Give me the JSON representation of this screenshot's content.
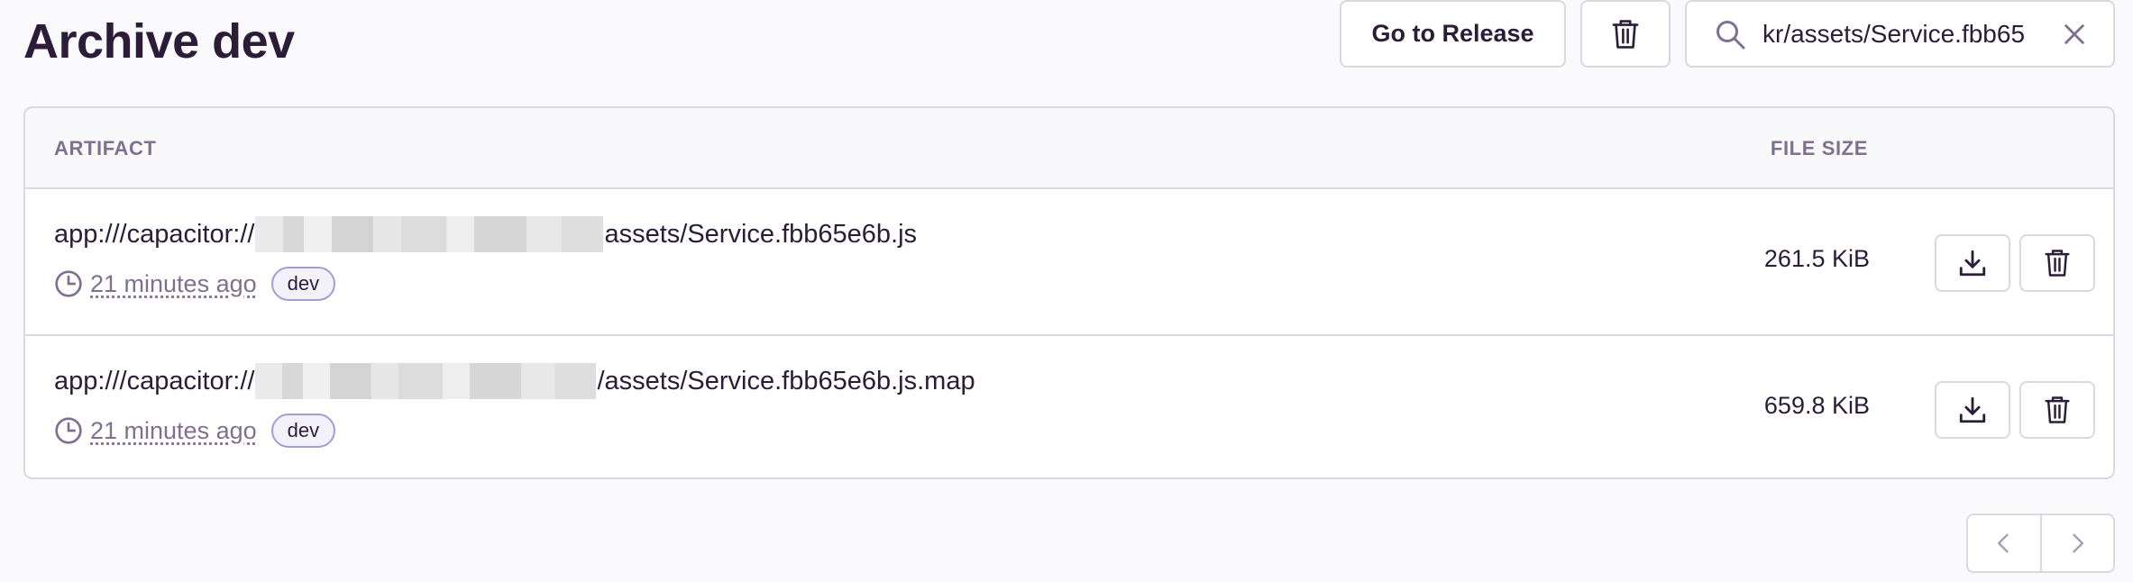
{
  "page": {
    "title": "Archive dev"
  },
  "header": {
    "go_to_release_label": "Go to Release",
    "search": {
      "value": "kr/assets/Service.fbb65"
    }
  },
  "table": {
    "columns": {
      "artifact": "ARTIFACT",
      "file_size": "FILE SIZE"
    },
    "rows": [
      {
        "name_prefix": "app:///capacitor://",
        "name_suffix": "assets/Service.fbb65e6b.js",
        "time": "21 minutes ago",
        "tag": "dev",
        "size": "261.5 KiB"
      },
      {
        "name_prefix": "app:///capacitor://",
        "name_suffix": "/assets/Service.fbb65e6b.js.map",
        "time": "21 minutes ago",
        "tag": "dev",
        "size": "659.8 KiB"
      }
    ]
  },
  "icons": {
    "trash": "trash-icon",
    "search": "search-icon",
    "clear": "close-icon",
    "clock": "clock-icon",
    "download": "download-icon",
    "prev": "chevron-left-icon",
    "next": "chevron-right-icon"
  },
  "colors": {
    "text": "#2b1d38",
    "muted": "#80708f",
    "border": "#dcd8e2",
    "tag_border": "#a79bd7",
    "background": "#faf9fb"
  }
}
